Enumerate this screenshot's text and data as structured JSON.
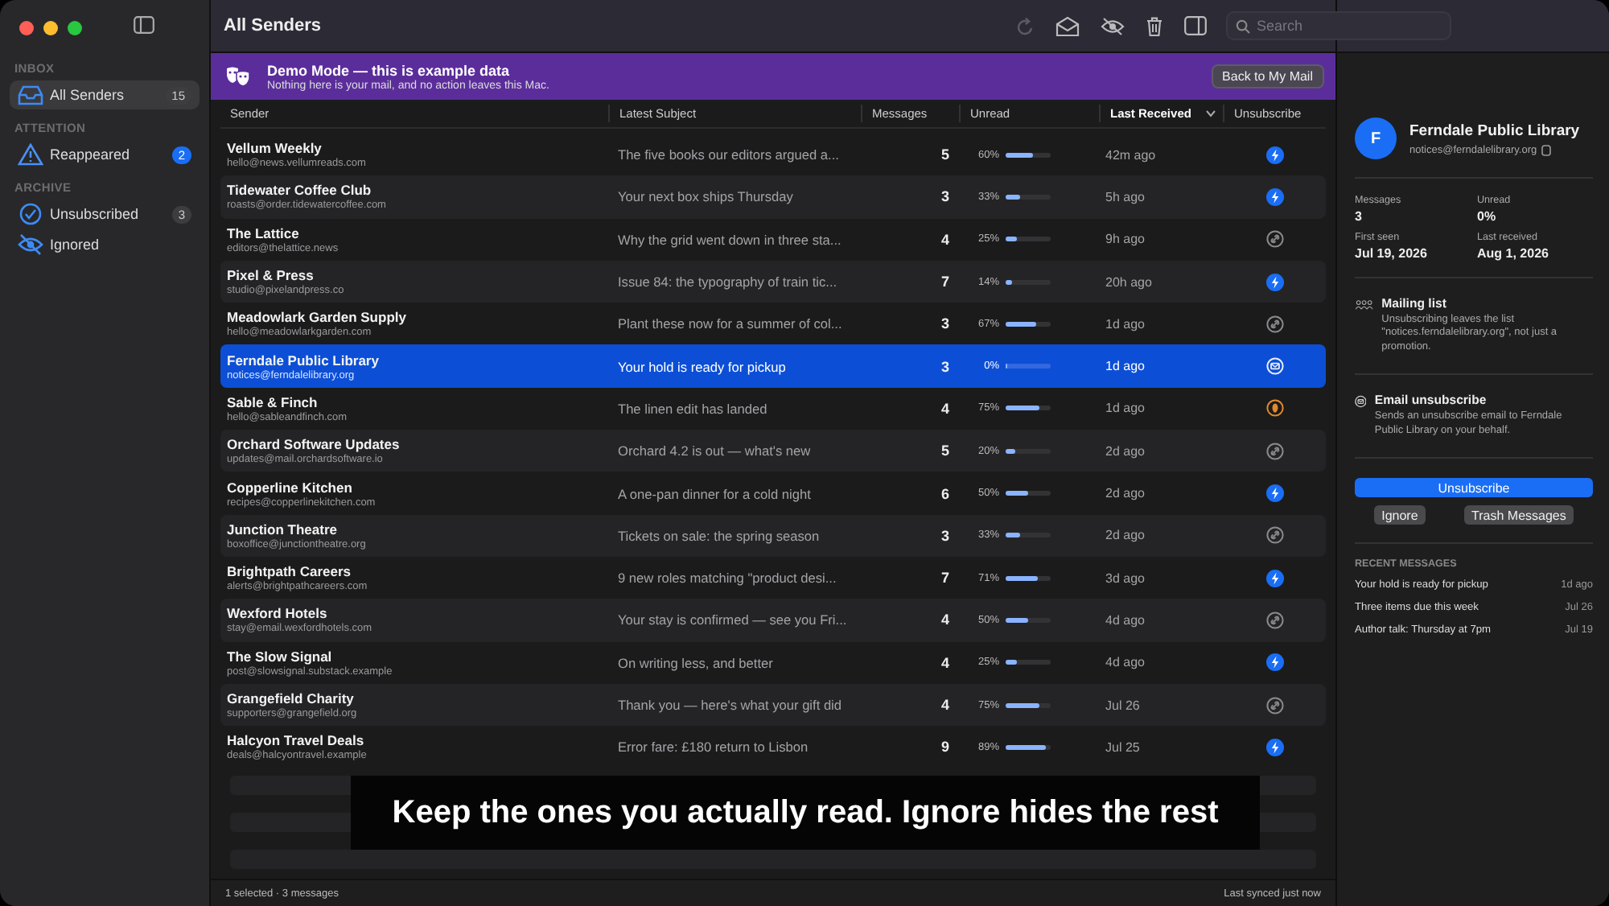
{
  "window": {
    "title": "All Senders"
  },
  "sidebar": {
    "sections": [
      {
        "heading": "INBOX",
        "items": [
          {
            "label": "All Senders",
            "count": "15",
            "attention": false,
            "selected": true
          }
        ]
      },
      {
        "heading": "ATTENTION",
        "items": [
          {
            "label": "Reappeared",
            "count": "2",
            "attention": true,
            "selected": false
          }
        ]
      },
      {
        "heading": "ARCHIVE",
        "items": [
          {
            "label": "Unsubscribed",
            "count": "3",
            "attention": false,
            "selected": false
          },
          {
            "label": "Ignored",
            "attention": false,
            "selected": false
          }
        ]
      }
    ]
  },
  "toolbar": {
    "search": {
      "placeholder": "Search"
    }
  },
  "banner": {
    "title": "Demo Mode — this is example data",
    "text": "Nothing here is your mail, and no action leaves this Mac.",
    "button": "Back to My Mail"
  },
  "table": {
    "columns": [
      {
        "label": "Sender",
        "sorted": false
      },
      {
        "label": "Latest Subject",
        "sorted": false
      },
      {
        "label": "Messages",
        "sorted": false
      },
      {
        "label": "Unread",
        "sorted": false
      },
      {
        "label": "Last Received",
        "sorted": true
      },
      {
        "label": "Unsubscribe",
        "sorted": false
      }
    ],
    "rows": [
      {
        "name": "Vellum Weekly",
        "email": "hello@news.vellumreads.com",
        "subject": "The five books our editors argued a...",
        "messages": "5",
        "unread": "60%",
        "level": 0.6,
        "received": "42m ago",
        "kind": "oneclick",
        "selected": false
      },
      {
        "name": "Tidewater Coffee Club",
        "email": "roasts@order.tidewatercoffee.com",
        "subject": "Your next box ships Thursday",
        "messages": "3",
        "unread": "33%",
        "level": 0.33,
        "received": "5h ago",
        "kind": "oneclick",
        "selected": false
      },
      {
        "name": "The Lattice",
        "email": "editors@thelattice.news",
        "subject": "Why the grid went down in three sta...",
        "messages": "4",
        "unread": "25%",
        "level": 0.25,
        "received": "9h ago",
        "kind": "link",
        "selected": false
      },
      {
        "name": "Pixel & Press",
        "email": "studio@pixelandpress.co",
        "subject": "Issue 84: the typography of train tic...",
        "messages": "7",
        "unread": "14%",
        "level": 0.14,
        "received": "20h ago",
        "kind": "oneclick",
        "selected": false
      },
      {
        "name": "Meadowlark Garden Supply",
        "email": "hello@meadowlarkgarden.com",
        "subject": "Plant these now for a summer of col...",
        "messages": "3",
        "unread": "67%",
        "level": 0.67,
        "received": "1d ago",
        "kind": "link",
        "selected": false
      },
      {
        "name": "Ferndale Public Library",
        "email": "notices@ferndalelibrary.org",
        "subject": "Your hold is ready for pickup",
        "messages": "3",
        "unread": "0%",
        "level": 0,
        "received": "1d ago",
        "kind": "email",
        "selected": true
      },
      {
        "name": "Sable & Finch",
        "email": "hello@sableandfinch.com",
        "subject": "The linen edit has landed",
        "messages": "4",
        "unread": "75%",
        "level": 0.75,
        "received": "1d ago",
        "kind": "manual",
        "selected": false
      },
      {
        "name": "Orchard Software Updates",
        "email": "updates@mail.orchardsoftware.io",
        "subject": "Orchard 4.2 is out — what's new",
        "messages": "5",
        "unread": "20%",
        "level": 0.2,
        "received": "2d ago",
        "kind": "link",
        "selected": false
      },
      {
        "name": "Copperline Kitchen",
        "email": "recipes@copperlinekitchen.com",
        "subject": "A one-pan dinner for a cold night",
        "messages": "6",
        "unread": "50%",
        "level": 0.5,
        "received": "2d ago",
        "kind": "oneclick",
        "selected": false
      },
      {
        "name": "Junction Theatre",
        "email": "boxoffice@junctiontheatre.org",
        "subject": "Tickets on sale: the spring season",
        "messages": "3",
        "unread": "33%",
        "level": 0.33,
        "received": "2d ago",
        "kind": "link",
        "selected": false
      },
      {
        "name": "Brightpath Careers",
        "email": "alerts@brightpathcareers.com",
        "subject": "9 new roles matching \"product desi...",
        "messages": "7",
        "unread": "71%",
        "level": 0.71,
        "received": "3d ago",
        "kind": "oneclick",
        "selected": false
      },
      {
        "name": "Wexford Hotels",
        "email": "stay@email.wexfordhotels.com",
        "subject": "Your stay is confirmed — see you Fri...",
        "messages": "4",
        "unread": "50%",
        "level": 0.5,
        "received": "4d ago",
        "kind": "link",
        "selected": false
      },
      {
        "name": "The Slow Signal",
        "email": "post@slowsignal.substack.example",
        "subject": "On writing less, and better",
        "messages": "4",
        "unread": "25%",
        "level": 0.25,
        "received": "4d ago",
        "kind": "oneclick",
        "selected": false
      },
      {
        "name": "Grangefield Charity",
        "email": "supporters@grangefield.org",
        "subject": "Thank you — here's what your gift did",
        "messages": "4",
        "unread": "75%",
        "level": 0.75,
        "received": "Jul 26",
        "kind": "link",
        "selected": false
      },
      {
        "name": "Halcyon Travel Deals",
        "email": "deals@halcyontravel.example",
        "subject": "Error fare: £180 return to Lisbon",
        "messages": "9",
        "unread": "89%",
        "level": 0.89,
        "received": "Jul 25",
        "kind": "oneclick",
        "selected": false
      }
    ]
  },
  "detail": {
    "avatar": "F",
    "name": "Ferndale Public Library",
    "email": "notices@ferndalelibrary.org",
    "stats": [
      {
        "label": "Messages",
        "value": "3"
      },
      {
        "label": "Unread",
        "value": "0%"
      },
      {
        "label": "First seen",
        "value": "Jul 19, 2026"
      },
      {
        "label": "Last received",
        "value": "Aug 1, 2026"
      }
    ],
    "notes": [
      {
        "kind": "list",
        "title": "Mailing list",
        "text": "Unsubscribing leaves the list \"notices.ferndalelibrary.org\", not just a promotion."
      },
      {
        "kind": "email",
        "title": "Email unsubscribe",
        "text": "Sends an unsubscribe email to Ferndale Public Library on your behalf."
      }
    ],
    "primary_button": "Unsubscribe",
    "buttons": [
      "Ignore",
      "Trash Messages"
    ],
    "recent_heading": "RECENT MESSAGES",
    "recent": [
      {
        "subject": "Your hold is ready for pickup",
        "date": "1d ago"
      },
      {
        "subject": "Three items due this week",
        "date": "Jul 26"
      },
      {
        "subject": "Author talk: Thursday at 7pm",
        "date": "Jul 19"
      }
    ]
  },
  "status_bar": {
    "left": "1 selected · 3 messages",
    "right": "Last synced just now"
  },
  "caption": "Keep the ones you actually read. Ignore hides the rest"
}
